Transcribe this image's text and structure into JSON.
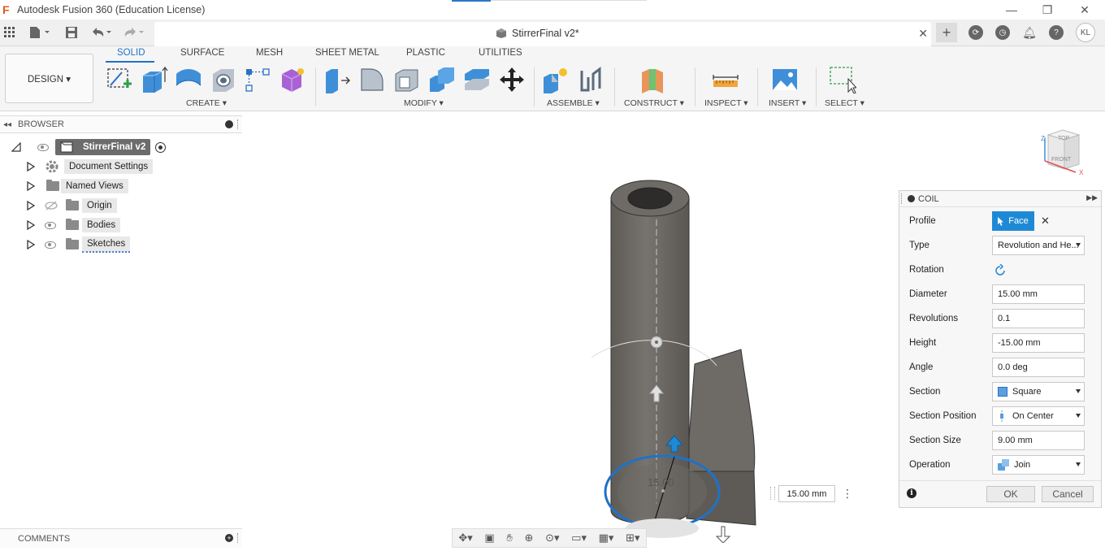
{
  "app": {
    "title": "Autodesk Fusion 360 (Education License)",
    "logo_letter": "F"
  },
  "window_controls": {
    "minimize": "—",
    "maximize": "❐",
    "close": "✕"
  },
  "document": {
    "title": "StirrerFinal v2*",
    "close": "✕"
  },
  "user": {
    "initials": "KL"
  },
  "workspace": {
    "label": "DESIGN ▾"
  },
  "ribbon": {
    "tabs": [
      {
        "label": "SOLID"
      },
      {
        "label": "SURFACE"
      },
      {
        "label": "MESH"
      },
      {
        "label": "SHEET METAL"
      },
      {
        "label": "PLASTIC"
      },
      {
        "label": "UTILITIES"
      }
    ],
    "groups": {
      "create": "CREATE ▾",
      "modify": "MODIFY ▾",
      "assemble": "ASSEMBLE ▾",
      "construct": "CONSTRUCT ▾",
      "inspect": "INSPECT ▾",
      "insert": "INSERT ▾",
      "select": "SELECT ▾"
    }
  },
  "browser": {
    "header": "BROWSER",
    "root": "StirrerFinal v2",
    "items": [
      {
        "label": "Document Settings"
      },
      {
        "label": "Named Views"
      },
      {
        "label": "Origin"
      },
      {
        "label": "Bodies"
      },
      {
        "label": "Sketches"
      }
    ]
  },
  "comments": {
    "label": "COMMENTS"
  },
  "viewcube": {
    "top": "TOP",
    "front": "FRONT",
    "axis_z": "Z",
    "axis_x": "X"
  },
  "viewport": {
    "dimension_label": "15.00",
    "dimension_input": "15.00 mm"
  },
  "coil": {
    "title": "COIL",
    "rows": {
      "profile": {
        "label": "Profile",
        "value": "Face"
      },
      "type": {
        "label": "Type",
        "value": "Revolution and He..."
      },
      "rotation": {
        "label": "Rotation"
      },
      "diameter": {
        "label": "Diameter",
        "value": "15.00 mm"
      },
      "revolutions": {
        "label": "Revolutions",
        "value": "0.1"
      },
      "height": {
        "label": "Height",
        "value": "-15.00 mm"
      },
      "angle": {
        "label": "Angle",
        "value": "0.0 deg"
      },
      "section": {
        "label": "Section",
        "value": "Square"
      },
      "section_position": {
        "label": "Section Position",
        "value": "On Center"
      },
      "section_size": {
        "label": "Section Size",
        "value": "9.00 mm"
      },
      "operation": {
        "label": "Operation",
        "value": "Join"
      }
    },
    "ok": "OK",
    "cancel": "Cancel"
  },
  "colors": {
    "accent": "#1e72c8",
    "selection_blue": "#1e8ad6",
    "body_gray": "#6e6b67"
  }
}
